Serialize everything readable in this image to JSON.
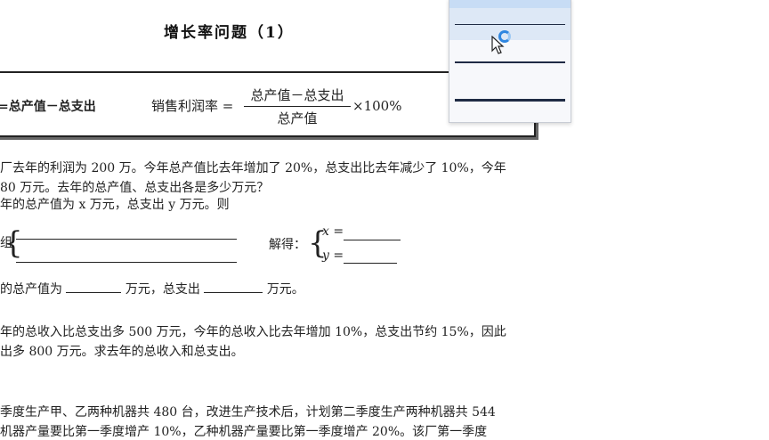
{
  "doc": {
    "title": "增长率问题（1）",
    "formula": {
      "left": "=总产值－总支出",
      "label": "销售利润率 =",
      "numerator": "总产值－总支出",
      "denominator": "总产值",
      "times": "×100%"
    },
    "lines": [
      "厂去年的利润为 200 万。今年总产值比去年增加了 20%，总支出比去年减少了 10%，今年",
      "80 万元。去年的总产值、总支出各是多少万元？",
      "年的总产值为 x 万元，总支出 y 万元。则",
      "组",
      "解得：",
      "x =",
      "y =",
      "的总产值为",
      "万元，总支出",
      "万元。",
      "年的总收入比总支出多 500 万元，今年的总收入比去年增加 10%，总支出节约 15%，因此",
      "出多 800 万元。求去年的总收入和总支出。",
      "季度生产甲、乙两种机器共 480 台，改进生产技术后，计划第二季度生产两种机器共 544",
      "机器产量要比第一季度增产 10%，乙种机器产量要比第一季度增产 20%。该厂第一季度"
    ]
  },
  "popup": {
    "options": [
      "thin-line",
      "medium-line",
      "thick-line"
    ]
  }
}
